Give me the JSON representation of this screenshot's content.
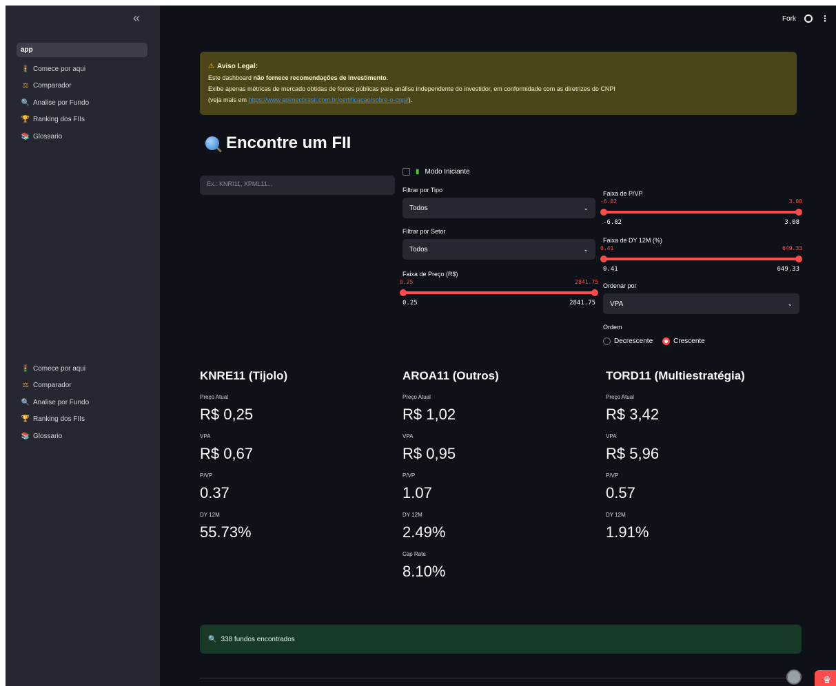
{
  "sidebar": {
    "collapse_label": "«",
    "items": [
      {
        "label": "app",
        "icon": "app-icon",
        "glyph": ""
      },
      {
        "label": "Comece por aqui",
        "icon": "traffic-light-icon",
        "glyph": "🚦"
      },
      {
        "label": "Comparador",
        "icon": "scales-icon",
        "glyph": "⚖"
      },
      {
        "label": "Analise por Fundo",
        "icon": "magnifier-icon",
        "glyph": "🔍"
      },
      {
        "label": "Ranking dos FIIs",
        "icon": "trophy-icon",
        "glyph": "🏆"
      },
      {
        "label": "Glossario",
        "icon": "books-icon",
        "glyph": "📚"
      }
    ],
    "items2": [
      {
        "label": "Comece por aqui",
        "icon": "traffic-light-icon",
        "glyph": "🚦"
      },
      {
        "label": "Comparador",
        "icon": "scales-icon",
        "glyph": "⚖"
      },
      {
        "label": "Analise por Fundo",
        "icon": "magnifier-icon",
        "glyph": "🔍"
      },
      {
        "label": "Ranking dos FIIs",
        "icon": "trophy-icon",
        "glyph": "🏆"
      },
      {
        "label": "Glossario",
        "icon": "books-icon",
        "glyph": "📚"
      }
    ]
  },
  "topbar": {
    "fork_label": "Fork",
    "more_label": "⋮"
  },
  "alert": {
    "title": "Aviso Legal:",
    "line1_pre": "Este dashboard ",
    "line1_bold": "não fornece recomendações de investimento",
    "line1_post": ".",
    "line2": "Exibe apenas métricas de mercado obtidas de fontes públicas para análise independente do investidor, em conformidade com as diretrizes do CNPI",
    "line3_pre": "(veja mais em ",
    "line3_link": "https://www.apimecbrasil.com.br/certificacao/sobre-o-cnpi/",
    "line3_post": ")."
  },
  "page_title": "Encontre um FII",
  "search": {
    "placeholder": "Ex.: KNRI11, XPML11..."
  },
  "filters": {
    "beginner_mode": "Modo Iniciante",
    "tipo_label": "Filtrar por Tipo",
    "tipo_value": "Todos",
    "setor_label": "Filtrar por Setor",
    "setor_value": "Todos",
    "preco_label": "Faixa de Preço (R$)",
    "preco_min": "0.25",
    "preco_max": "2841.75",
    "pvp_label": "Faixa de P/VP",
    "pvp_min": "-6.82",
    "pvp_max": "3.08",
    "dy_label": "Faixa de DY 12M (%)",
    "dy_min": "0.41",
    "dy_max": "649.33",
    "order_by_label": "Ordenar por",
    "order_by_value": "VPA",
    "order_label": "Ordem",
    "order_desc": "Decrescente",
    "order_asc": "Crescente",
    "order_selected": "Crescente"
  },
  "cards": [
    {
      "title": "KNRE11 (Tijolo)",
      "metrics": [
        {
          "label": "Preço Atual",
          "value": "R$ 0,25"
        },
        {
          "label": "VPA",
          "value": "R$ 0,67"
        },
        {
          "label": "P/VP",
          "value": "0.37"
        },
        {
          "label": "DY 12M",
          "value": "55.73%"
        }
      ]
    },
    {
      "title": "AROA11 (Outros)",
      "metrics": [
        {
          "label": "Preço Atual",
          "value": "R$ 1,02"
        },
        {
          "label": "VPA",
          "value": "R$ 0,95"
        },
        {
          "label": "P/VP",
          "value": "1.07"
        },
        {
          "label": "DY 12M",
          "value": "2.49%"
        },
        {
          "label": "Cap Rate",
          "value": "8.10%"
        }
      ]
    },
    {
      "title": "TORD11 (Multiestratégia)",
      "metrics": [
        {
          "label": "Preço Atual",
          "value": "R$ 3,42"
        },
        {
          "label": "VPA",
          "value": "R$ 5,96"
        },
        {
          "label": "P/VP",
          "value": "0.57"
        },
        {
          "label": "DY 12M",
          "value": "1.91%"
        }
      ]
    }
  ],
  "result": {
    "text": "338 fundos encontrados",
    "icon": "magnifier-icon"
  },
  "colors": {
    "accent": "#ff4b4b",
    "background": "#0e1117",
    "sidebar": "#262730",
    "warning_bg": "#4a4617",
    "success_bg": "#173928"
  }
}
